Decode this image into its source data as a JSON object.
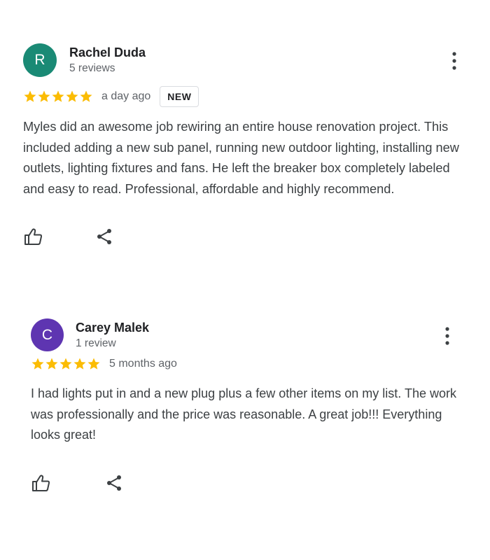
{
  "reviews": [
    {
      "avatar_letter": "R",
      "avatar_color": "#1a8a75",
      "author_name": "Rachel Duda",
      "author_meta": "5 reviews",
      "rating": 5,
      "date": "a day ago",
      "badge": "NEW",
      "text": "Myles did an awesome job rewiring an entire house renovation project. This included adding a new sub panel, running new outdoor lighting, installing new outlets, lighting fixtures and fans. He left the breaker box completely labeled and easy to read. Professional, affordable and highly recommend.",
      "actions": [
        "thumbs-up-icon",
        "share-icon"
      ]
    },
    {
      "avatar_letter": "C",
      "avatar_color": "#5e35b1",
      "author_name": "Carey Malek",
      "author_meta": "1 review",
      "rating": 5,
      "date": "5 months ago",
      "text": "I had lights put in and a new plug plus a few other items on my list. The work was professionally and the price was reasonable. A great job!!! Everything looks great!",
      "actions": [
        "thumbs-up-icon",
        "share-icon"
      ]
    }
  ],
  "colors": {
    "star": "#fbbc04",
    "icon": "#3c4043"
  },
  "icons": {
    "menu": "more-vert-icon",
    "like": "thumbs-up-icon",
    "share": "share-icon",
    "star": "star-icon"
  }
}
